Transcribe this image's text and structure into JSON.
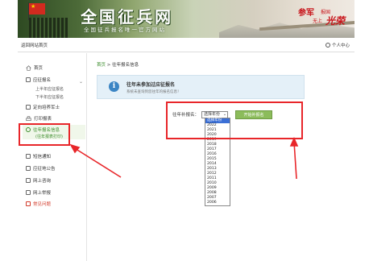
{
  "header": {
    "site_title": "全国征兵网",
    "site_subtitle": "全国征兵报名唯一官方网站",
    "slogan_join": "参军",
    "slogan_country": "报国",
    "slogan_no_regret": "无上",
    "slogan_glory": "光荣"
  },
  "topnav": {
    "back_link": "返回网站首页",
    "personal_center": "个人中心"
  },
  "sidebar": {
    "items": [
      {
        "label": "首页",
        "icon": "home-icon"
      },
      {
        "label": "应征报名",
        "icon": "document-icon"
      },
      {
        "label": "上半年应征报名"
      },
      {
        "label": "下半年应征报名"
      },
      {
        "label": "定向培养军士",
        "icon": "document-icon"
      },
      {
        "label": "打印报表",
        "icon": "printer-icon"
      },
      {
        "label": "往年报名信息",
        "icon": "clock-icon"
      },
      {
        "label": "(往年报表打印)"
      },
      {
        "label": "短信通知",
        "icon": "message-icon"
      },
      {
        "label": "应征地公告",
        "icon": "document-icon"
      },
      {
        "label": "网上咨询",
        "icon": "chat-icon"
      },
      {
        "label": "网上举报",
        "icon": "monitor-icon"
      },
      {
        "label": "常见问题",
        "icon": "question-icon"
      }
    ]
  },
  "breadcrumb": {
    "home": "首页",
    "separator": ">",
    "current": "往年报名信息"
  },
  "notice": {
    "title": "往年未参加过应征报名",
    "description": "系统未查询到您往年的报名信息！"
  },
  "form": {
    "label": "往年补报名：",
    "selected_value": "选择年份",
    "button_label": "开始补报名",
    "year_options": [
      "选择年份",
      "2022",
      "2021",
      "2020",
      "2019",
      "2018",
      "2017",
      "2016",
      "2015",
      "2014",
      "2013",
      "2012",
      "2011",
      "2010",
      "2009",
      "2008",
      "2007",
      "2006"
    ]
  },
  "colors": {
    "accent_green": "#3a8c2a",
    "highlight_red": "#e8262a",
    "button_green": "#8cbc5b",
    "notice_bg": "#e4f0f8",
    "info_blue": "#3b85c4"
  }
}
